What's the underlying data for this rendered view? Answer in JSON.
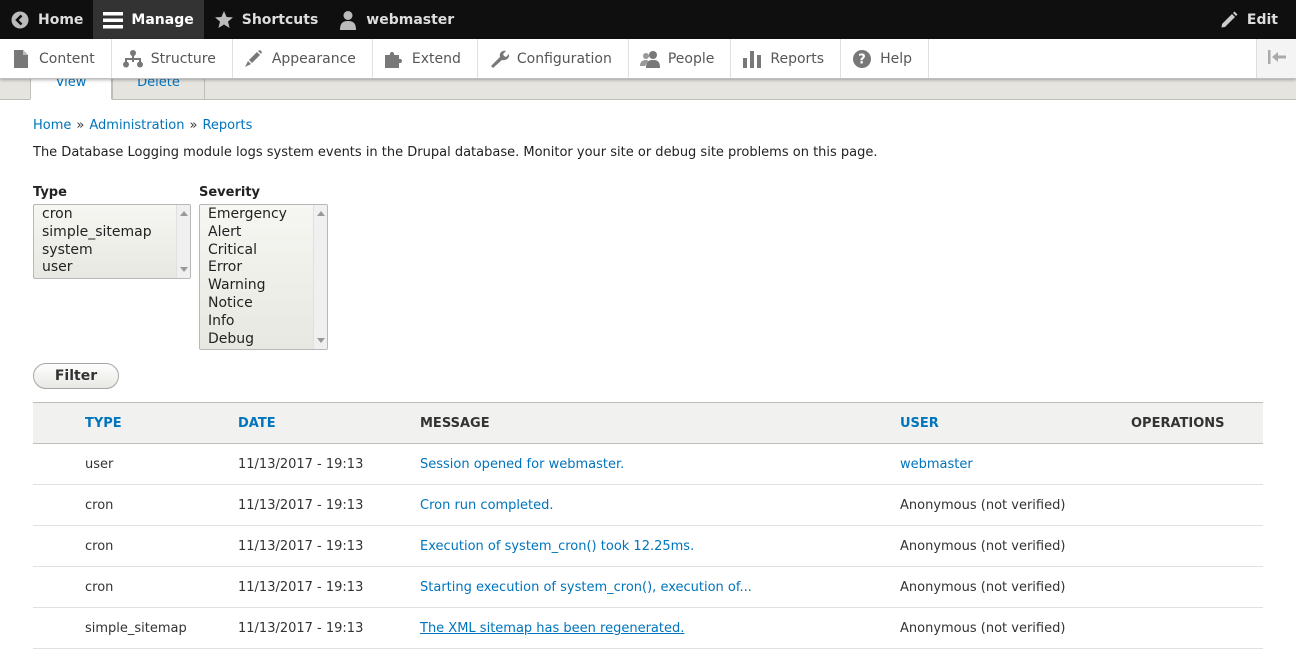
{
  "toolbar": {
    "home": "Home",
    "manage": "Manage",
    "shortcuts": "Shortcuts",
    "user": "webmaster",
    "edit": "Edit"
  },
  "tray": {
    "items": [
      {
        "label": "Content",
        "icon": "file-icon"
      },
      {
        "label": "Structure",
        "icon": "sitemap-icon"
      },
      {
        "label": "Appearance",
        "icon": "paintbrush-icon"
      },
      {
        "label": "Extend",
        "icon": "puzzle-icon"
      },
      {
        "label": "Configuration",
        "icon": "wrench-icon"
      },
      {
        "label": "People",
        "icon": "people-icon"
      },
      {
        "label": "Reports",
        "icon": "bar-chart-icon"
      },
      {
        "label": "Help",
        "icon": "help-icon"
      }
    ]
  },
  "tabs": {
    "view": "View",
    "delete": "Delete"
  },
  "breadcrumb": {
    "home": "Home",
    "administration": "Administration",
    "reports": "Reports",
    "separator": "»"
  },
  "intro": "The Database Logging module logs system events in the Drupal database. Monitor your site or debug site problems on this page.",
  "filters": {
    "type_label": "Type",
    "type_options": [
      "cron",
      "simple_sitemap",
      "system",
      "user"
    ],
    "severity_label": "Severity",
    "severity_options": [
      "Emergency",
      "Alert",
      "Critical",
      "Error",
      "Warning",
      "Notice",
      "Info",
      "Debug"
    ],
    "filter_button": "Filter"
  },
  "table": {
    "headers": {
      "type": "TYPE",
      "date": "DATE",
      "message": "MESSAGE",
      "user": "USER",
      "operations": "OPERATIONS"
    },
    "rows": [
      {
        "type": "user",
        "date": "11/13/2017 - 19:13",
        "message": "Session opened for webmaster.",
        "user": "webmaster"
      },
      {
        "type": "cron",
        "date": "11/13/2017 - 19:13",
        "message": "Cron run completed.",
        "user": "Anonymous (not verified)"
      },
      {
        "type": "cron",
        "date": "11/13/2017 - 19:13",
        "message": "Execution of system_cron() took 12.25ms.",
        "user": "Anonymous (not verified)"
      },
      {
        "type": "cron",
        "date": "11/13/2017 - 19:13",
        "message": "Starting execution of system_cron(), execution of...",
        "user": "Anonymous (not verified)"
      },
      {
        "type": "simple_sitemap",
        "date": "11/13/2017 - 19:13",
        "message": "The XML sitemap has been regenerated.",
        "user": "Anonymous (not verified)"
      }
    ]
  }
}
